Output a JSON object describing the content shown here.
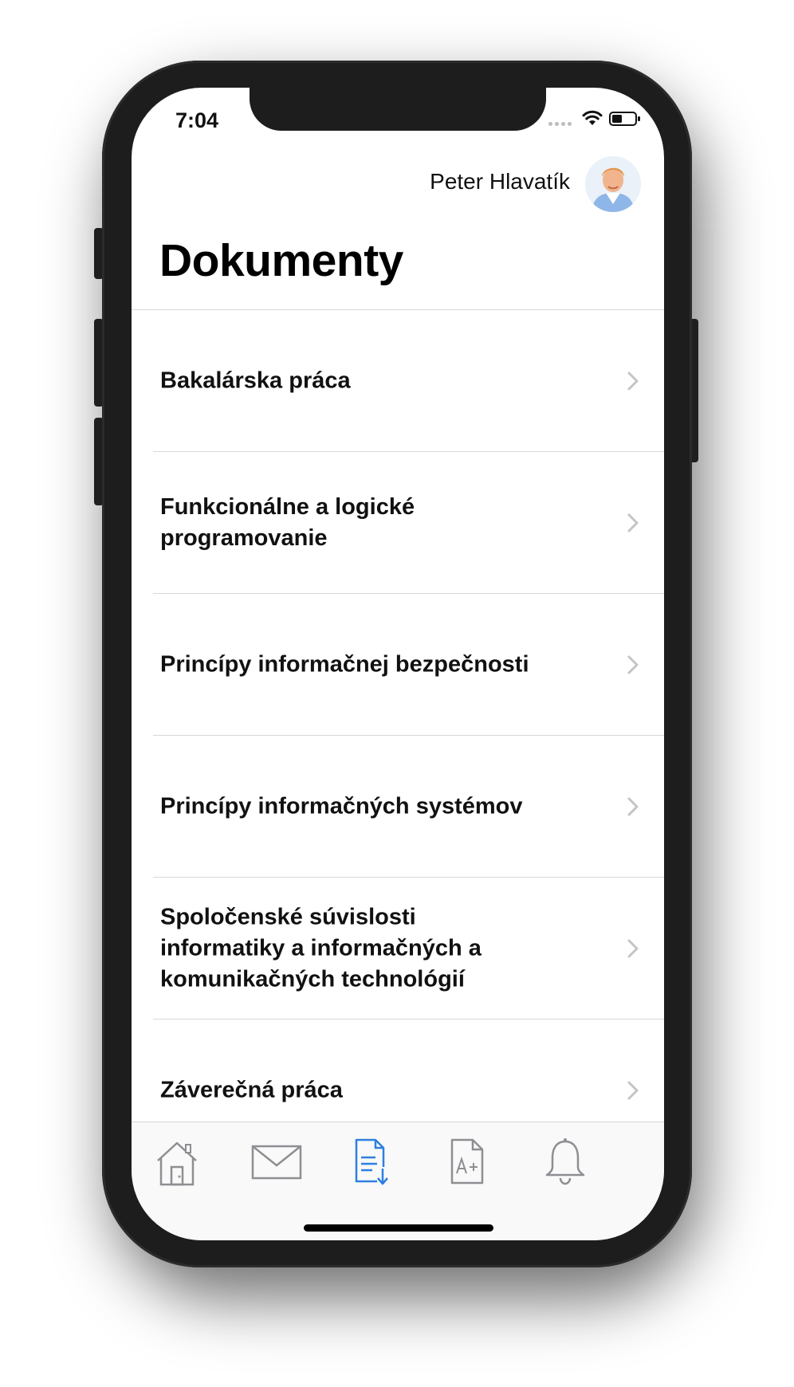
{
  "status_bar": {
    "time": "7:04"
  },
  "header": {
    "user_name": "Peter Hlavatík",
    "title": "Dokumenty"
  },
  "documents": [
    {
      "label": "Bakalárska práca"
    },
    {
      "label": "Funkcionálne a logické programovanie"
    },
    {
      "label": "Princípy informačnej bezpečnosti"
    },
    {
      "label": "Princípy informačných systémov"
    },
    {
      "label": "Spoločenské súvislosti informatiky a informačných a komunikačných technológií"
    },
    {
      "label": "Záverečná práca"
    }
  ],
  "tab_bar": {
    "active_tab": "documents",
    "tabs": [
      {
        "id": "home",
        "icon": "home-icon"
      },
      {
        "id": "mail",
        "icon": "mail-icon"
      },
      {
        "id": "documents",
        "icon": "document-download-icon"
      },
      {
        "id": "grades",
        "icon": "grade-document-icon"
      },
      {
        "id": "notifications",
        "icon": "bell-icon"
      }
    ]
  },
  "colors": {
    "accent": "#2f7fe0",
    "inactive_icon": "#8e8e93",
    "chevron": "#c4c4c7"
  }
}
